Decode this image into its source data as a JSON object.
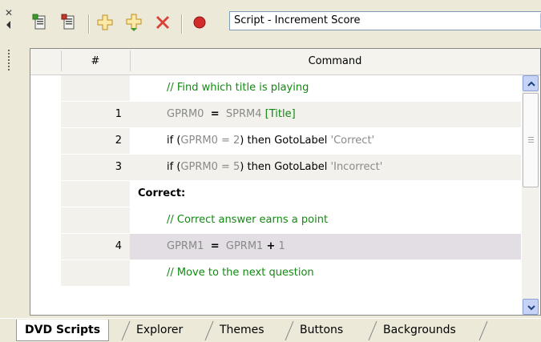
{
  "toolbar": {
    "script_select_value": "Script - Increment Score",
    "buttons": [
      "new-script",
      "delete-script",
      "add-command",
      "insert-command",
      "delete-command",
      "record"
    ]
  },
  "grid": {
    "headers": {
      "number": "#",
      "command": "Command"
    },
    "rows": [
      {
        "num": "",
        "kind": "comment",
        "text": "// Find which title is playing"
      },
      {
        "num": "1",
        "kind": "assign",
        "left": "GPRM0",
        "op": "=",
        "right": "SPRM4",
        "extra": "[Title]"
      },
      {
        "num": "2",
        "kind": "if",
        "if": "if",
        "lp": "(",
        "reg": "GPRM0",
        "cond": "= 2",
        "rp": ")",
        "then": "then",
        "goto": "GotoLabel",
        "label": "'Correct'"
      },
      {
        "num": "3",
        "kind": "if",
        "if": "if",
        "lp": "(",
        "reg": "GPRM0",
        "cond": "= 5",
        "rp": ")",
        "then": "then",
        "goto": "GotoLabel",
        "label": "'Incorrect'"
      },
      {
        "num": "",
        "kind": "label",
        "text": "Correct:"
      },
      {
        "num": "",
        "kind": "comment",
        "text": "// Correct answer earns a point"
      },
      {
        "num": "4",
        "kind": "assign2",
        "left": "GPRM1",
        "op": "=",
        "right": "GPRM1",
        "plus": "+",
        "val": "1"
      },
      {
        "num": "",
        "kind": "comment",
        "text": "// Move to the next question"
      }
    ]
  },
  "tabs": [
    "DVD Scripts",
    "Explorer",
    "Themes",
    "Buttons",
    "Backgrounds"
  ],
  "colors": {
    "comment": "#118a11",
    "register": "#8a8a8a",
    "highlight_row": "#e2dee4"
  }
}
